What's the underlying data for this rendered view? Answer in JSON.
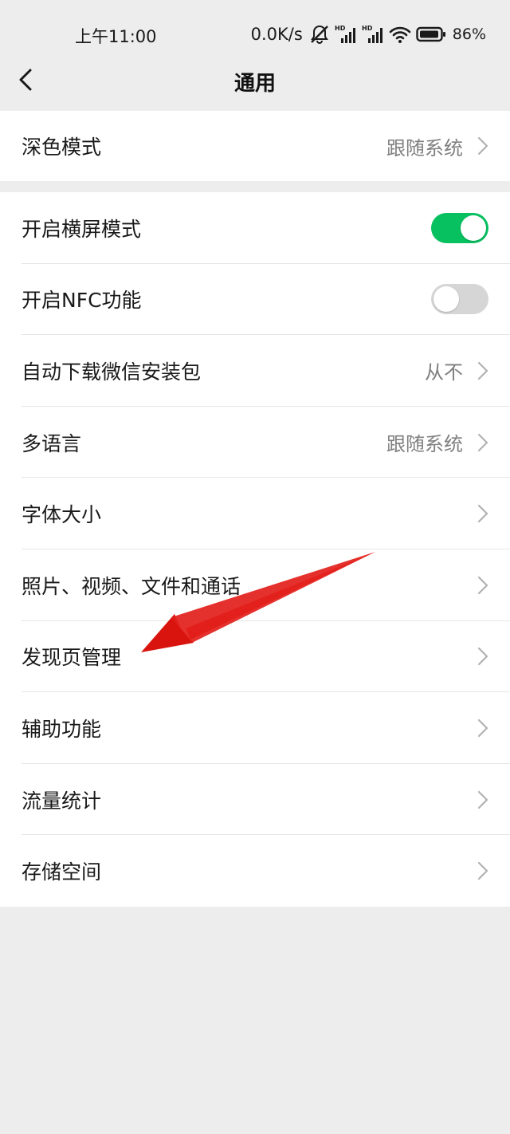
{
  "status_bar": {
    "time": "上午11:00",
    "net_speed": "0.0K/s",
    "battery_percent": "86%",
    "icons": [
      "mute-icon",
      "signal-hd-icon",
      "signal-hd-icon",
      "wifi-icon",
      "battery-icon"
    ]
  },
  "nav": {
    "title": "通用",
    "back_icon": "chevron-left-icon"
  },
  "colors": {
    "background": "#ededed",
    "card": "#ffffff",
    "accent_green": "#07c160",
    "toggle_off": "#d6d6d6",
    "annotation_red": "#e3201b"
  },
  "settings": {
    "dark_mode": {
      "label": "深色模式",
      "value": "跟随系统"
    },
    "landscape": {
      "label": "开启横屏模式",
      "on": true
    },
    "nfc": {
      "label": "开启NFC功能",
      "on": false
    },
    "auto_download": {
      "label": "自动下载微信安装包",
      "value": "从不"
    },
    "language": {
      "label": "多语言",
      "value": "跟随系统"
    },
    "font_size": {
      "label": "字体大小"
    },
    "media": {
      "label": "照片、视频、文件和通话"
    },
    "discover": {
      "label": "发现页管理"
    },
    "accessibility": {
      "label": "辅助功能"
    },
    "traffic": {
      "label": "流量统计"
    },
    "storage": {
      "label": "存储空间"
    }
  }
}
